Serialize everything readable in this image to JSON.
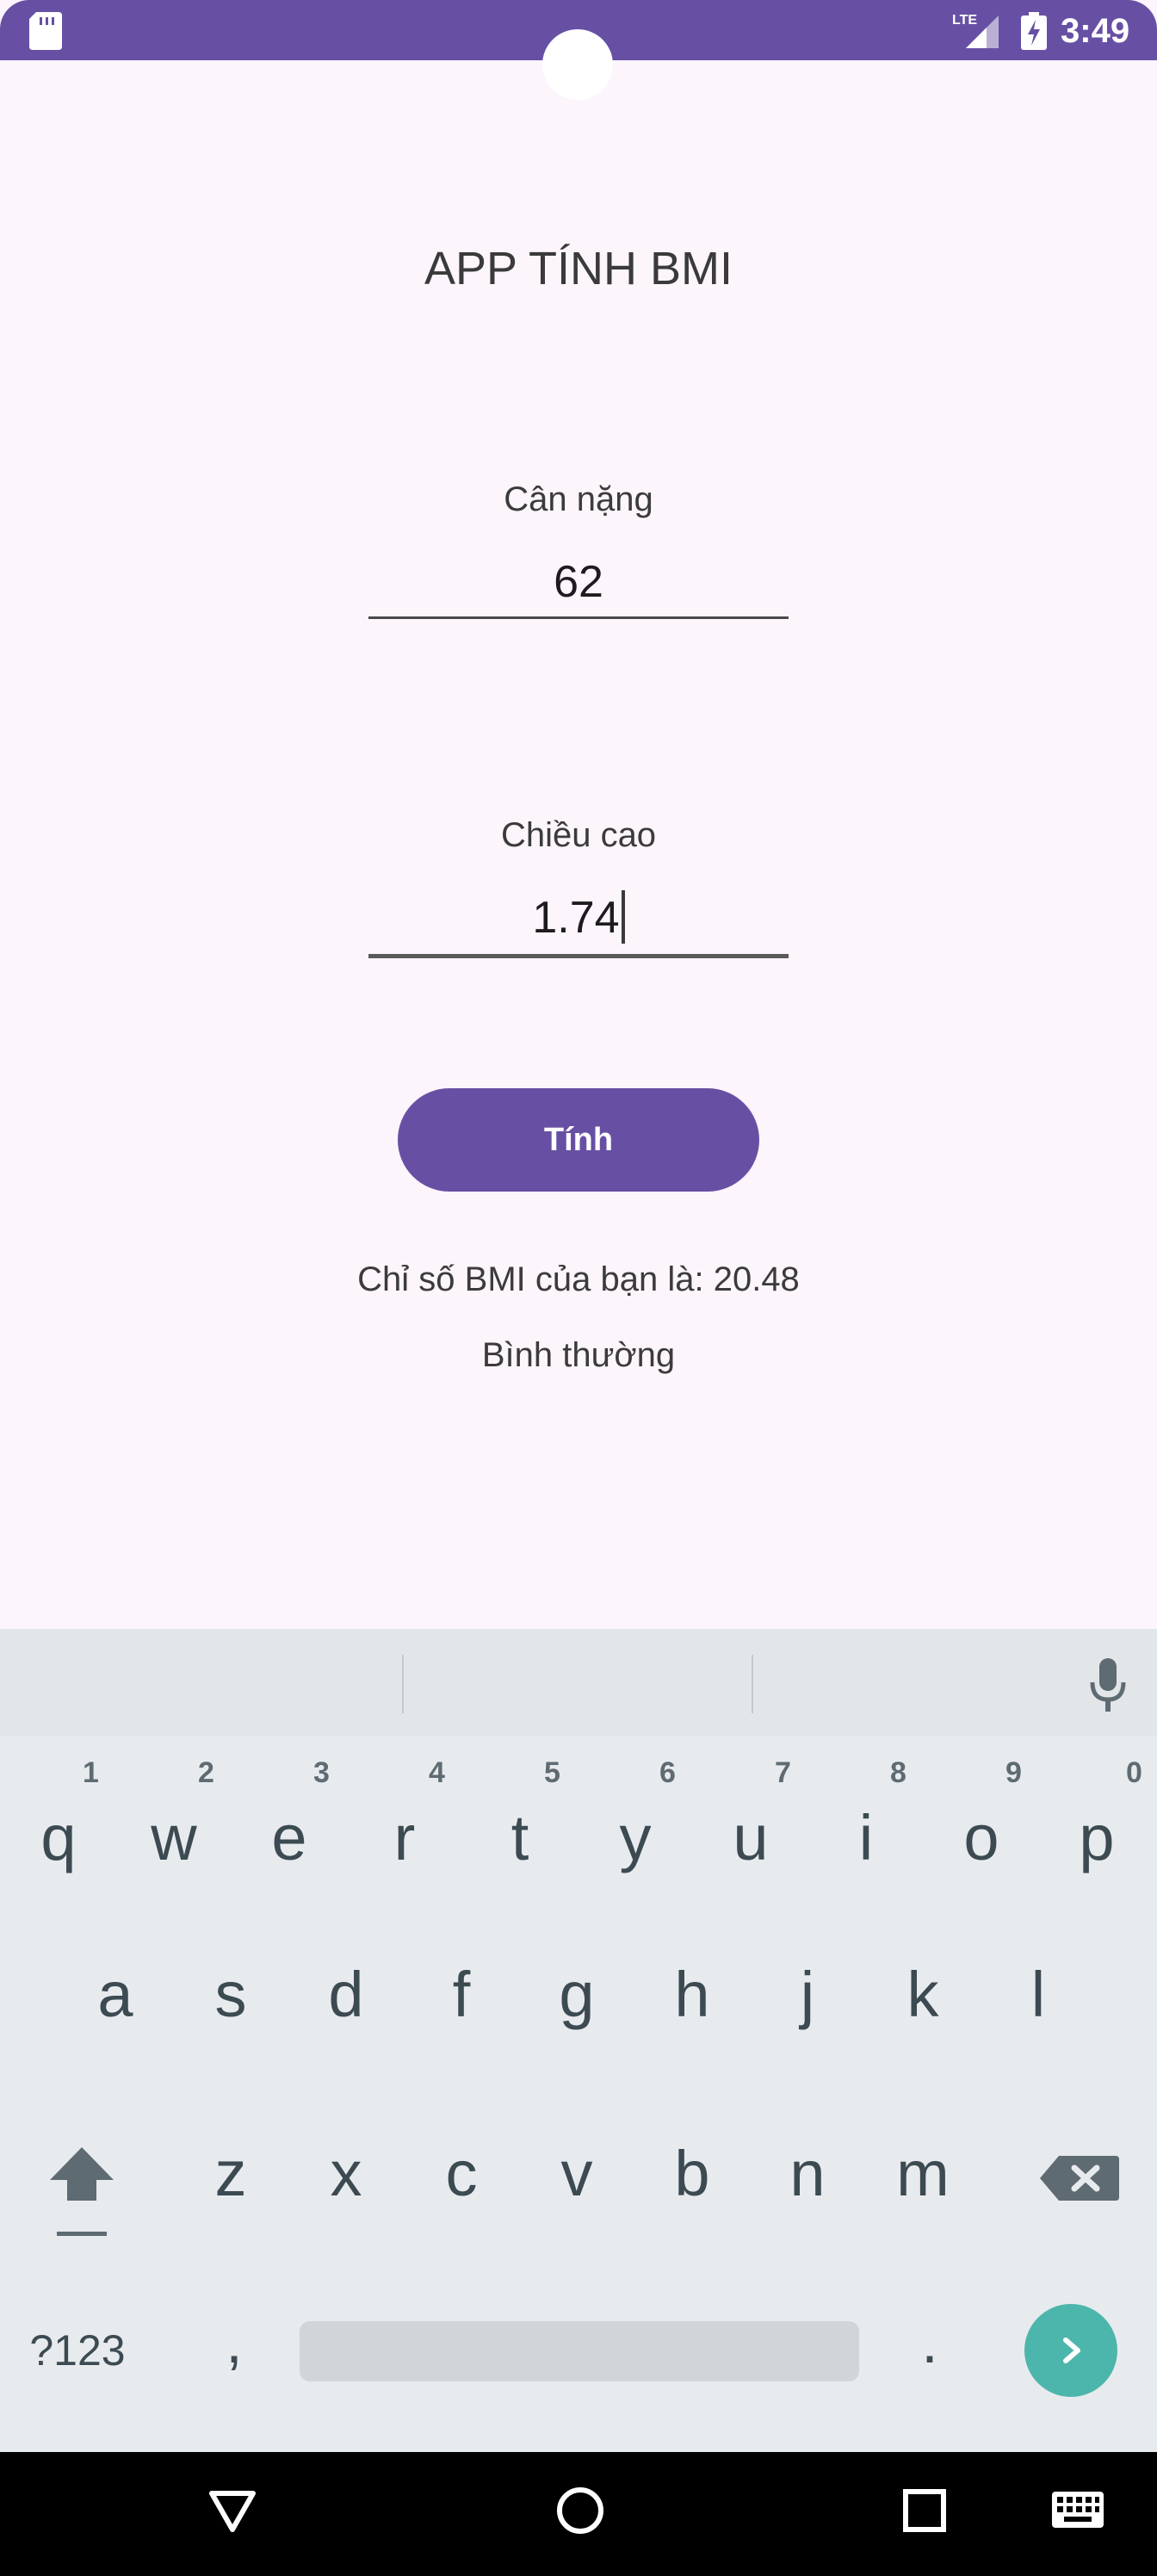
{
  "status_bar": {
    "time": "3:49",
    "network_label": "LTE",
    "background_color": "#6750a4",
    "icons": [
      "sd-card-icon",
      "signal-icon",
      "battery-charging-icon"
    ]
  },
  "app": {
    "title": "APP TÍNH BMI",
    "weight": {
      "label": "Cân nặng",
      "value": "62"
    },
    "height": {
      "label": "Chiều cao",
      "value": "1.74"
    },
    "calculate_button": "Tính",
    "result_text": "Chỉ số BMI của bạn là: 20.48",
    "status_text": "Bình thường",
    "accent_color": "#6750a4",
    "background_color": "#fcf5fc"
  },
  "keyboard": {
    "row1": [
      {
        "key": "q",
        "hint": "1"
      },
      {
        "key": "w",
        "hint": "2"
      },
      {
        "key": "e",
        "hint": "3"
      },
      {
        "key": "r",
        "hint": "4"
      },
      {
        "key": "t",
        "hint": "5"
      },
      {
        "key": "y",
        "hint": "6"
      },
      {
        "key": "u",
        "hint": "7"
      },
      {
        "key": "i",
        "hint": "8"
      },
      {
        "key": "o",
        "hint": "9"
      },
      {
        "key": "p",
        "hint": "0"
      }
    ],
    "row2": [
      "a",
      "s",
      "d",
      "f",
      "g",
      "h",
      "j",
      "k",
      "l"
    ],
    "row3": [
      "z",
      "x",
      "c",
      "v",
      "b",
      "n",
      "m"
    ],
    "symbols_label": "?123",
    "comma": ",",
    "period": ".",
    "enter_color": "#4db6ac",
    "icons": [
      "mic-icon",
      "shift-icon",
      "backspace-icon",
      "enter-arrow-icon"
    ]
  },
  "nav_bar": {
    "icons": [
      "back-icon",
      "home-icon",
      "recents-icon",
      "keyboard-switch-icon"
    ]
  }
}
